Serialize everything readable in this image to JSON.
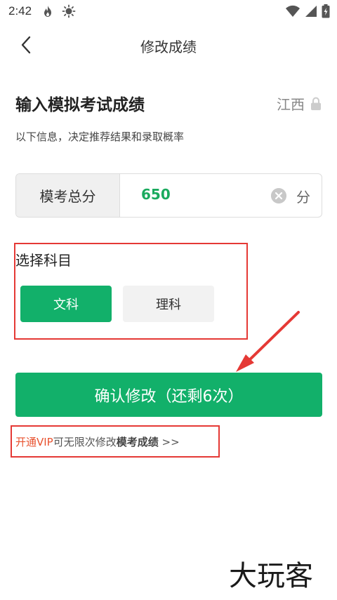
{
  "status_bar": {
    "time": "2:42",
    "left_icons": [
      "flame-icon",
      "sun-icon"
    ],
    "right_icons": [
      "wifi-icon",
      "signal-icon",
      "battery-icon"
    ]
  },
  "nav": {
    "back_icon": "chevron-left-icon",
    "title": "修改成绩"
  },
  "form": {
    "heading": "输入模拟考试成绩",
    "region": "江西",
    "region_icon": "lock-icon",
    "subtitle": "以下信息，决定推荐结果和录取概率",
    "score_label": "模考总分",
    "score_value": "650",
    "score_unit": "分",
    "subject_title": "选择科目",
    "subjects": [
      {
        "label": "文科",
        "selected": true
      },
      {
        "label": "理科",
        "selected": false
      }
    ],
    "confirm_label": "确认修改（还剩6次）",
    "vip": {
      "link_text": "开通VIP",
      "mid_text": "可无限次修改",
      "bold_text": "模考成绩",
      "suffix": " >>"
    }
  },
  "watermark_text": "大玩客",
  "colors": {
    "accent_green": "#12b06a",
    "score_green": "#1aaa5e",
    "vip_orange": "#e8522f",
    "annotation_red": "#e53935"
  }
}
